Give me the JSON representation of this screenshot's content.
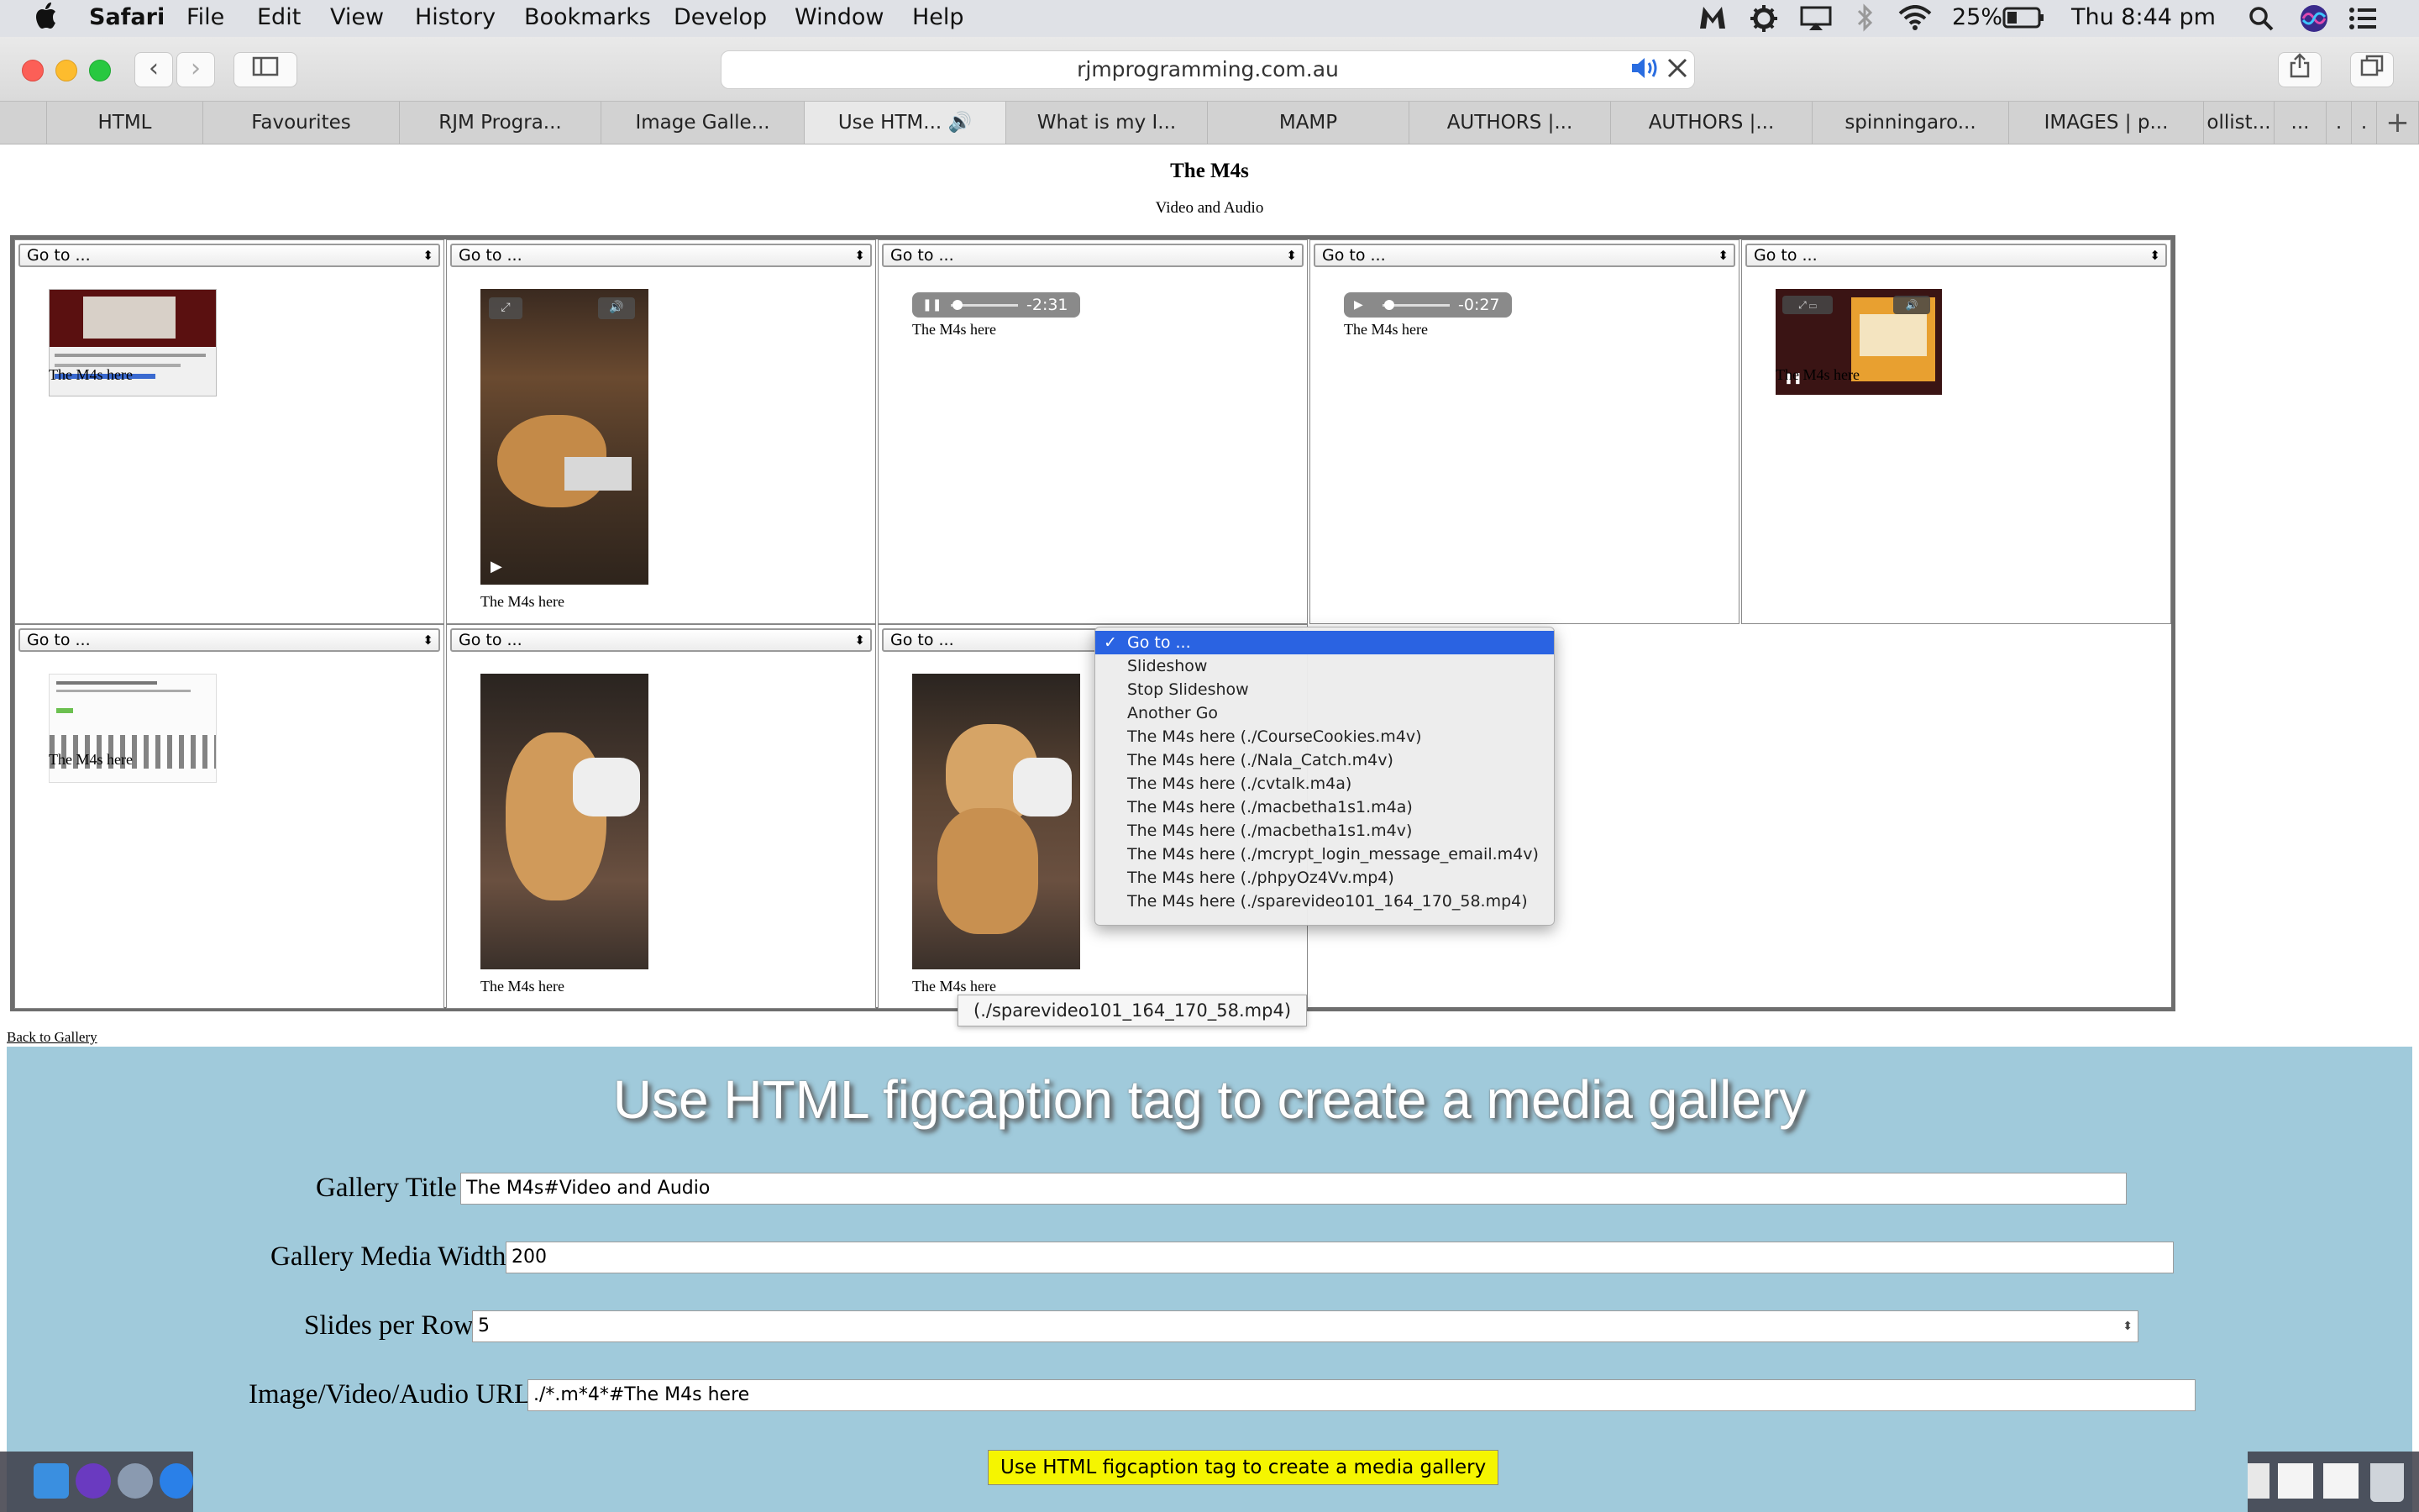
{
  "menubar": {
    "apple": "",
    "app": "Safari",
    "items": [
      "File",
      "Edit",
      "View",
      "History",
      "Bookmarks",
      "Develop",
      "Window",
      "Help"
    ],
    "battery": "25%",
    "clock": "Thu 8:44 pm"
  },
  "browser": {
    "url": "rjmprogramming.com.au",
    "tabs": [
      "HTML",
      "Favourites",
      "RJM Progra...",
      "Image Galle...",
      "Use HTM...",
      "What is my I...",
      "MAMP",
      "AUTHORS |...",
      "AUTHORS |...",
      "spinningaro...",
      "IMAGES | p...",
      "ollist...",
      "..."
    ],
    "active_tab": "Use HTM..."
  },
  "page": {
    "title": "The M4s",
    "subtitle": "Video and Audio",
    "select_label": "Go to ...",
    "caption": "The M4s here",
    "audio1_time": "-2:31",
    "audio2_time": "-0:27",
    "back_link": "Back to Gallery",
    "tooltip": "(./sparevideo101_164_170_58.mp4)"
  },
  "dropdown": {
    "options": [
      "Go to ...",
      "Slideshow",
      "Stop Slideshow",
      "Another Go",
      "The M4s here (./CourseCookies.m4v)",
      "The M4s here (./Nala_Catch.m4v)",
      "The M4s here (./cvtalk.m4a)",
      "The M4s here (./macbetha1s1.m4a)",
      "The M4s here (./macbetha1s1.m4v)",
      "The M4s here (./mcrypt_login_message_email.m4v)",
      "The M4s here (./phpyOz4Vv.mp4)",
      "The M4s here (./sparevideo101_164_170_58.mp4)"
    ],
    "selected_index": 0
  },
  "form": {
    "heading": "Use HTML figcaption tag to create a media gallery",
    "title_label": "Gallery Title",
    "title_value": "The M4s#Video and Audio",
    "width_label": "Gallery Media Width",
    "width_value": "200",
    "per_row_label": "Slides per Row",
    "per_row_value": "5",
    "url_label": "Image/Video/Audio URL",
    "url_value": "./*.m*4*#The M4s here",
    "submit_label": "Use HTML figcaption tag to create a media gallery"
  },
  "colors": {
    "form_bg": "#a0cadb",
    "submit_bg": "#f5f500",
    "selection_blue": "#2a63e2"
  }
}
